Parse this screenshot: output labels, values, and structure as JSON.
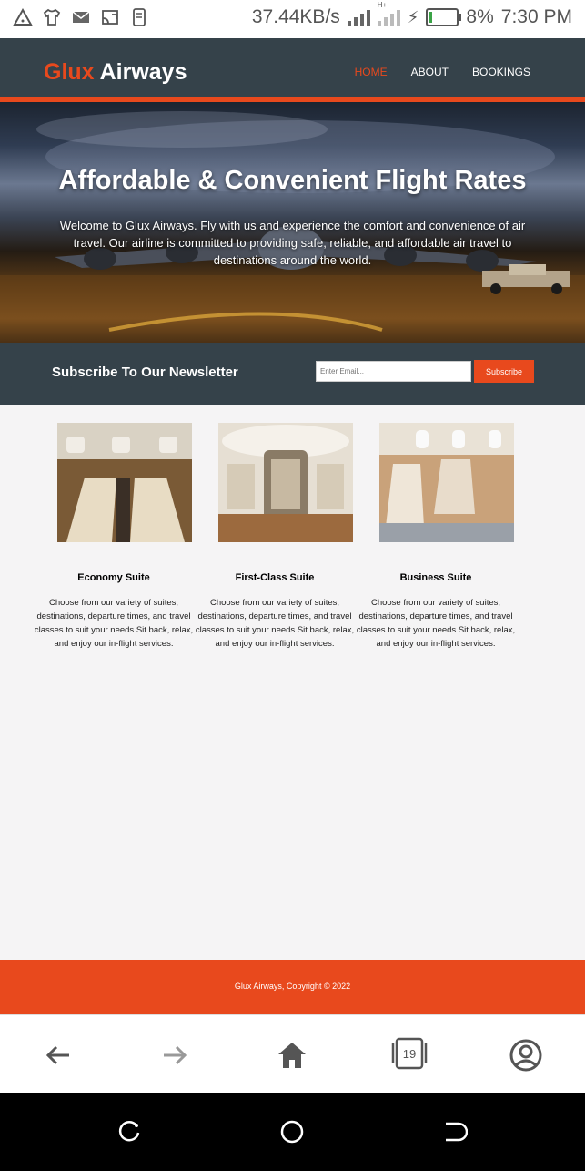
{
  "status_bar": {
    "speed": "37.44KB/s",
    "battery": "8%",
    "time": "7:30 PM",
    "network_label": "H+"
  },
  "header": {
    "brand_highlight": "Glux",
    "brand_rest": " Airways",
    "nav": [
      {
        "label": "HOME",
        "active": true
      },
      {
        "label": "ABOUT",
        "active": false
      },
      {
        "label": "BOOKINGS",
        "active": false
      }
    ]
  },
  "hero": {
    "title": "Affordable & Convenient Flight Rates",
    "text": "Welcome to Glux Airways. Fly with us and experience the comfort and convenience of air travel. Our airline is committed to providing safe, reliable, and affordable air travel to destinations around the world."
  },
  "newsletter": {
    "title": "Subscribe To Our Newsletter",
    "placeholder": "Enter Email...",
    "button": "Subscribe"
  },
  "boxes": [
    {
      "title": "Economy Suite",
      "text": "Choose from our variety of suites, destinations, departure times, and travel classes to suit your needs.Sit back, relax, and enjoy our in-flight services."
    },
    {
      "title": "First-Class Suite",
      "text": "Choose from our variety of suites, destinations, departure times, and travel classes to suit your needs.Sit back, relax, and enjoy our in-flight services."
    },
    {
      "title": "Business Suite",
      "text": "Choose from our variety of suites, destinations, departure times, and travel classes to suit your needs.Sit back, relax, and enjoy our in-flight services."
    }
  ],
  "footer": {
    "text": "Glux Airways, Copyright © 2022"
  },
  "browser": {
    "tab_count": "19",
    "icons": [
      "back-arrow-icon",
      "forward-arrow-icon",
      "home-icon",
      "tabs-icon",
      "account-icon"
    ]
  },
  "colors": {
    "accent": "#e8491d",
    "dark": "#35424a",
    "page_bg": "#f5f4f5"
  }
}
